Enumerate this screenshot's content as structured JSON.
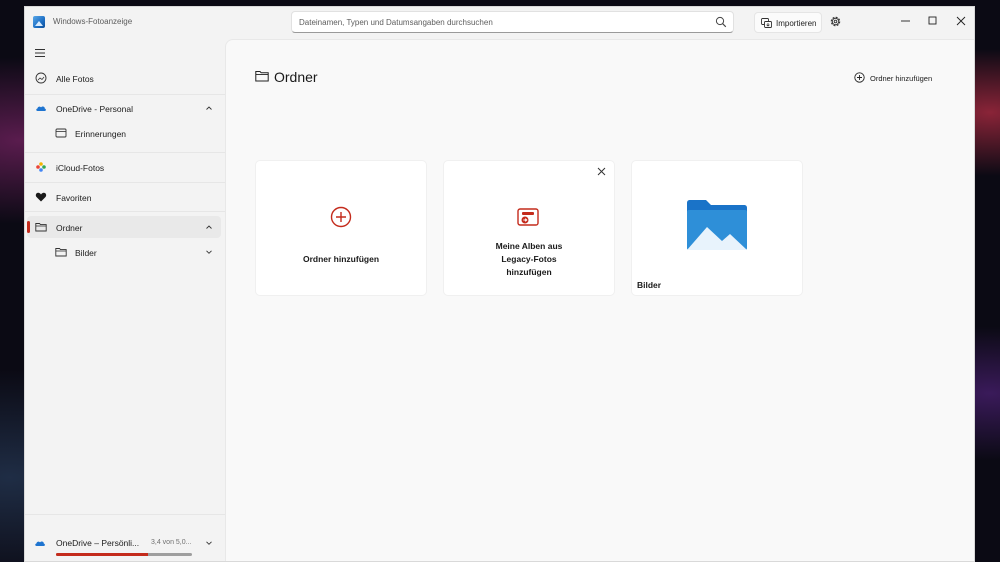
{
  "app": {
    "title": "Windows-Fotoanzeige"
  },
  "search": {
    "placeholder": "Dateinamen, Typen und Datumsangaben durchsuchen"
  },
  "toolbar": {
    "import_label": "Importieren"
  },
  "sidebar": {
    "items": [
      {
        "label": "Alle Fotos"
      },
      {
        "label": "OneDrive - Personal"
      },
      {
        "label": "Erinnerungen"
      },
      {
        "label": "iCloud-Fotos"
      },
      {
        "label": "Favoriten"
      },
      {
        "label": "Ordner"
      },
      {
        "label": "Bilder"
      }
    ],
    "storage": {
      "label": "OneDrive – Persönli...",
      "size": "3,4 von 5,0...",
      "used_fraction": 0.68
    }
  },
  "main": {
    "title": "Ordner",
    "add_folder_label": "Ordner hinzufügen",
    "cards": [
      {
        "label": "Ordner hinzufügen"
      },
      {
        "label_lines": [
          "Meine Alben aus",
          "Legacy-Fotos",
          "hinzufügen"
        ]
      },
      {
        "label": "Bilder"
      }
    ]
  },
  "colors": {
    "accent": "#c42b1c",
    "folder_blue": "#2e8fd8"
  }
}
